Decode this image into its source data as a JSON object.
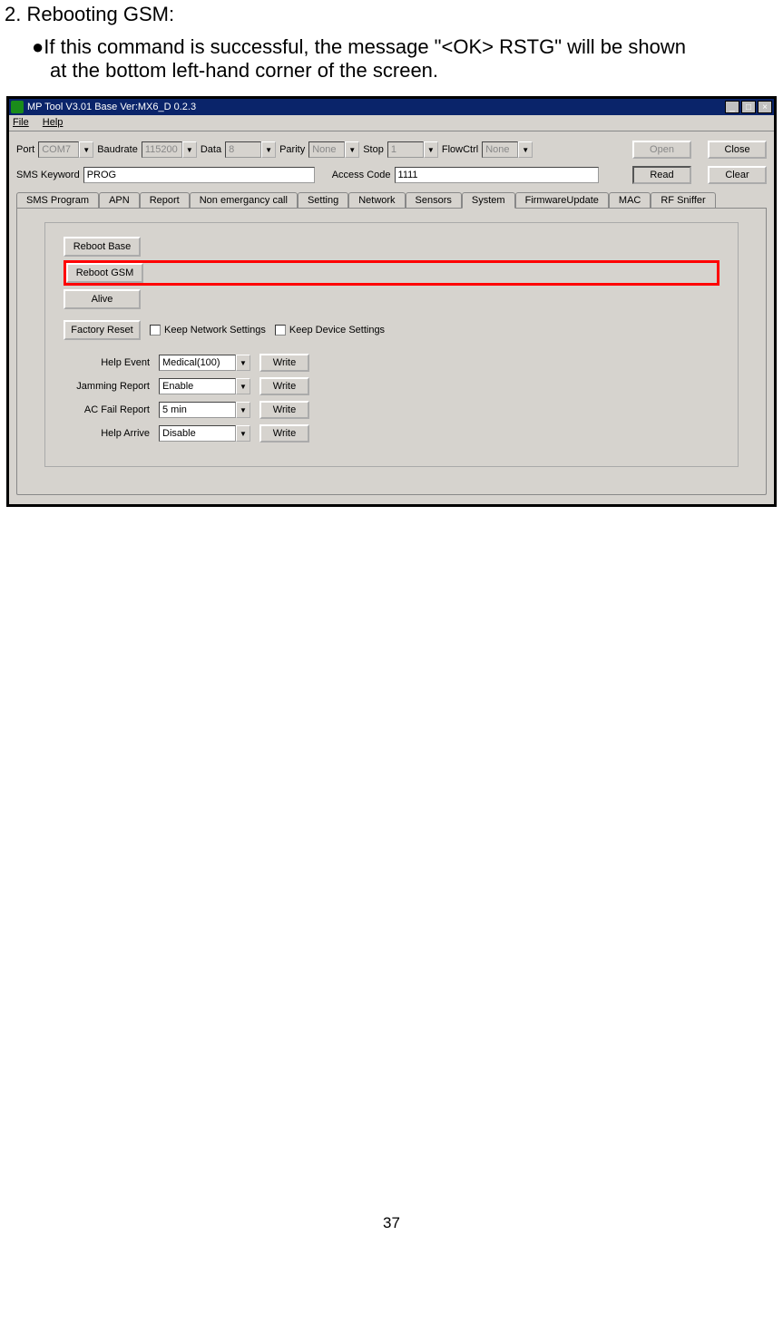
{
  "heading": "2.  Rebooting GSM:",
  "bullet": "●If this command is successful, the message \"<OK> RSTG\" will be shown",
  "bullet_cont": "at the bottom left-hand corner of the screen.",
  "app": {
    "title": "MP Tool V3.01  Base Ver:MX6_D 0.2.3",
    "menu": {
      "file": "File",
      "help": "Help"
    },
    "conn": {
      "port_lbl": "Port",
      "port_val": "COM7",
      "baud_lbl": "Baudrate",
      "baud_val": "115200",
      "data_lbl": "Data",
      "data_val": "8",
      "parity_lbl": "Parity",
      "parity_val": "None",
      "stop_lbl": "Stop",
      "stop_val": "1",
      "flow_lbl": "FlowCtrl",
      "flow_val": "None",
      "open_btn": "Open",
      "close_btn": "Close"
    },
    "sms": {
      "kw_lbl": "SMS Keyword",
      "kw_val": "PROG",
      "ac_lbl": "Access Code",
      "ac_val": "1111",
      "read_btn": "Read",
      "clear_btn": "Clear"
    },
    "tabs": {
      "sms_program": "SMS Program",
      "apn": "APN",
      "report": "Report",
      "non_emerg": "Non emergancy call",
      "setting": "Setting",
      "network": "Network",
      "sensors": "Sensors",
      "system": "System",
      "firmware": "FirmwareUpdate",
      "mac": "MAC",
      "rf": "RF Sniffer"
    },
    "system_tab": {
      "reboot_base": "Reboot Base",
      "reboot_gsm": "Reboot GSM",
      "alive": "Alive",
      "factory_reset": "Factory Reset",
      "keep_net": "Keep Network Settings",
      "keep_dev": "Keep Device Settings",
      "help_event_lbl": "Help Event",
      "help_event_val": "Medical(100)",
      "jamming_lbl": "Jamming Report",
      "jamming_val": "Enable",
      "ac_fail_lbl": "AC Fail Report",
      "ac_fail_val": "5 min",
      "help_arrive_lbl": "Help Arrive",
      "help_arrive_val": "Disable",
      "write_btn": "Write"
    }
  },
  "page_num": "37"
}
